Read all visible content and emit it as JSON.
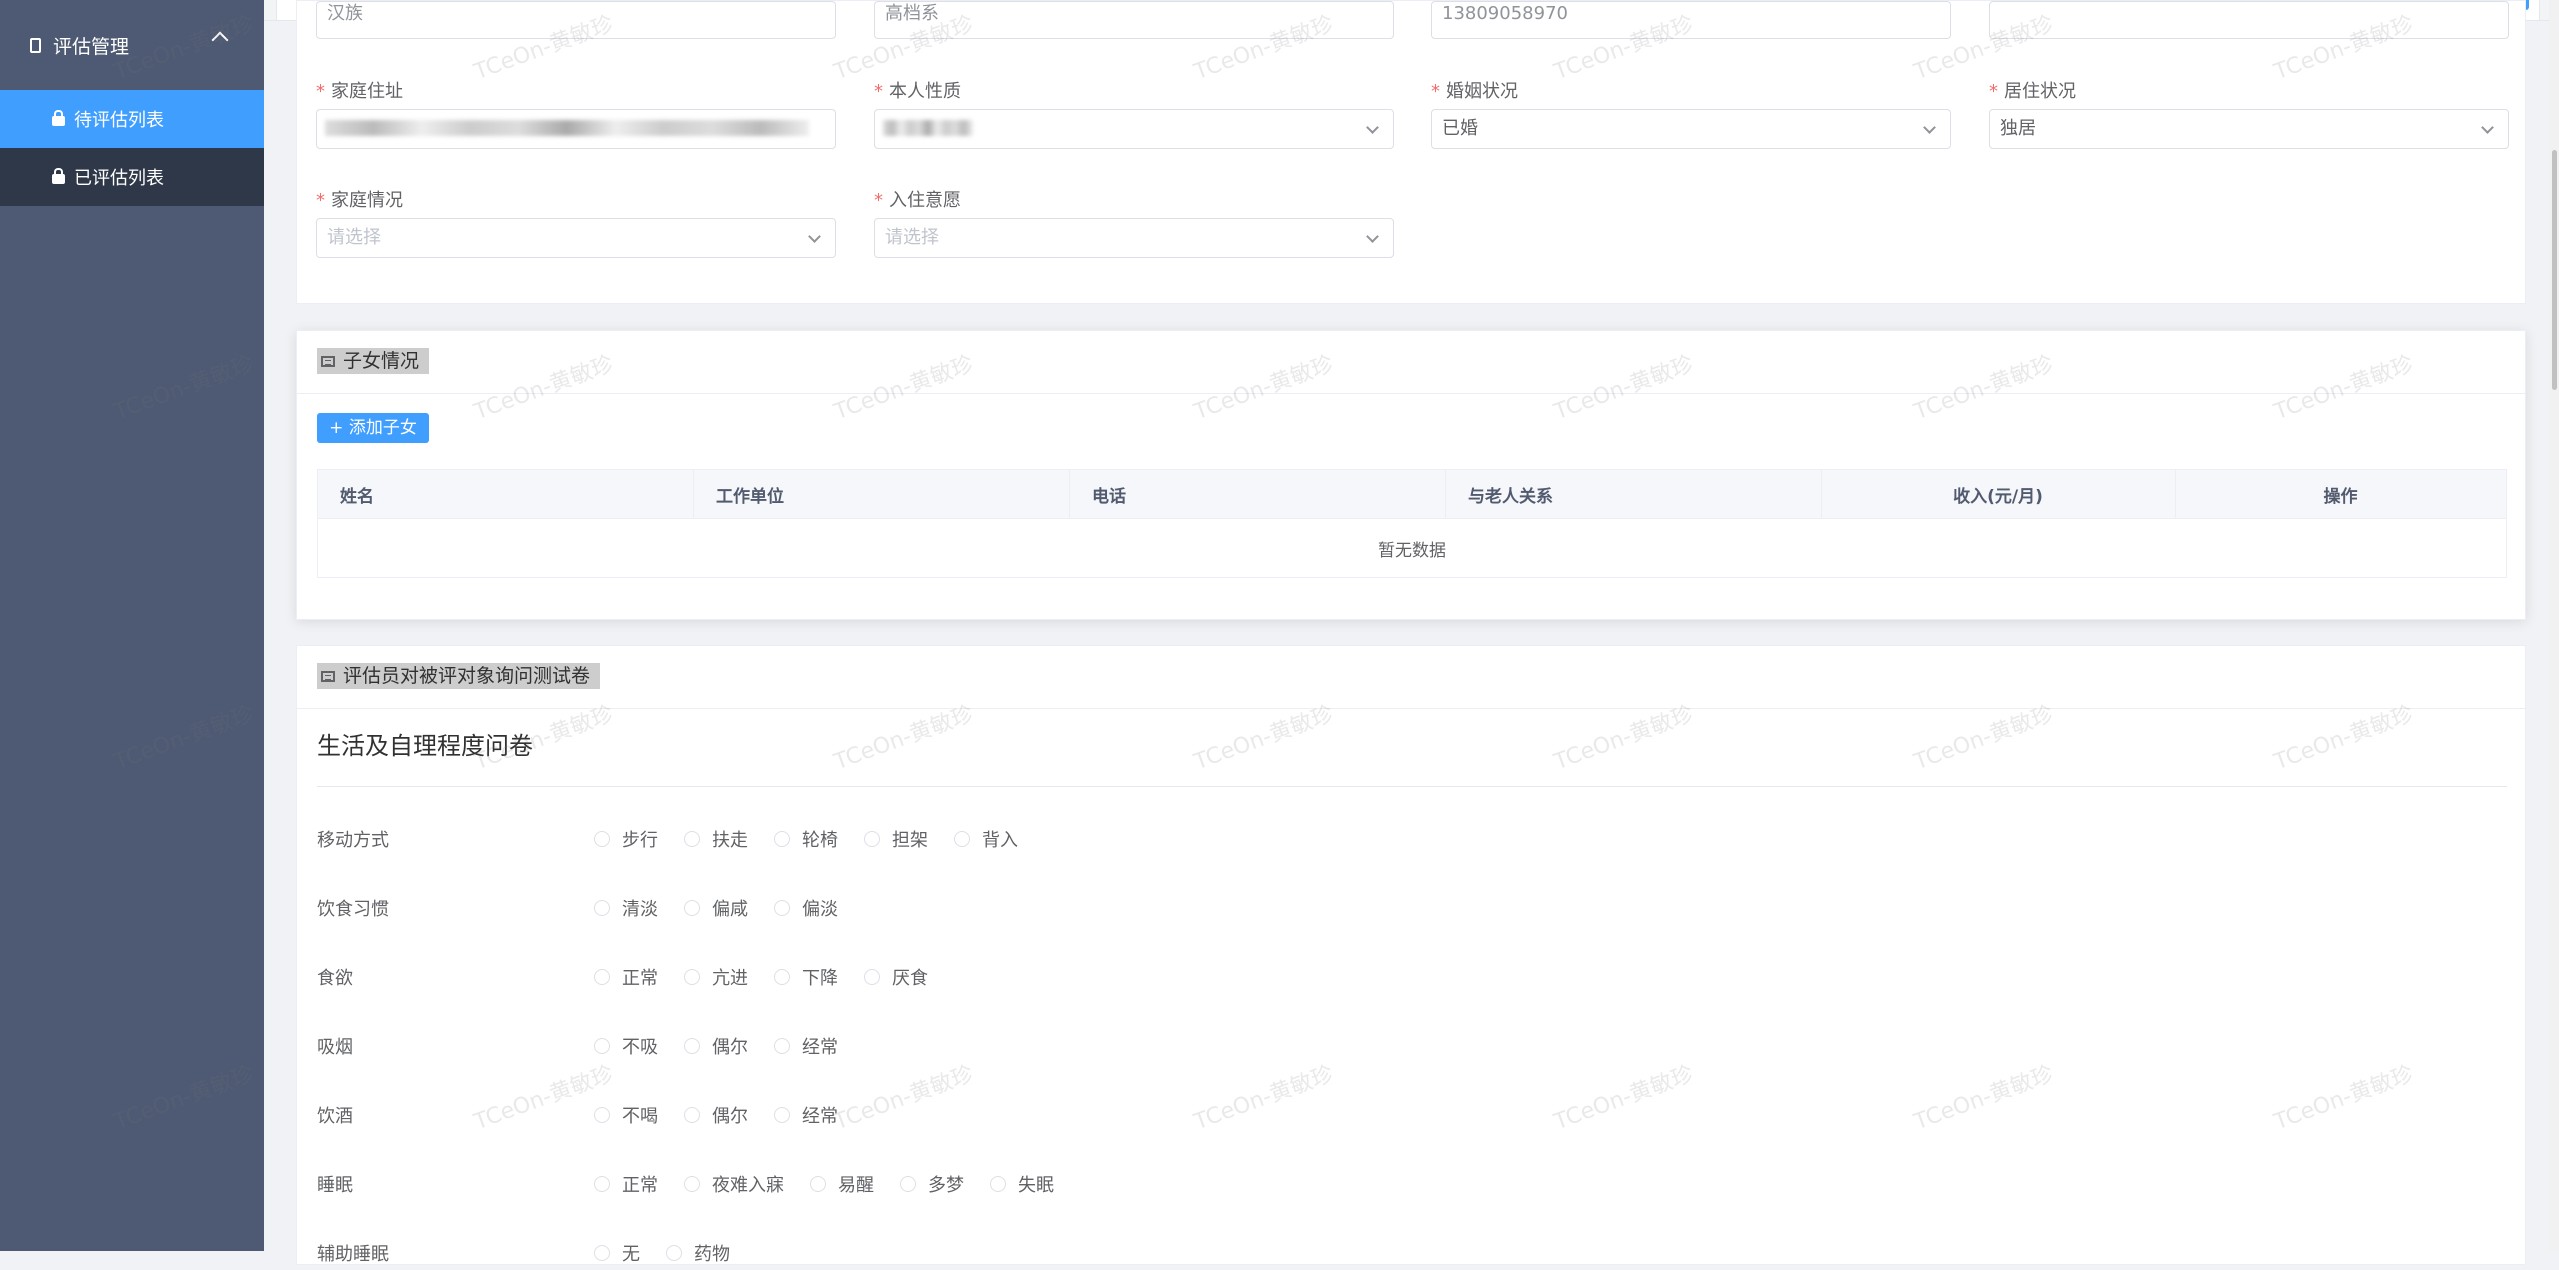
{
  "sidebar": {
    "group_label": "评估管理",
    "items": [
      {
        "label": "待评估列表",
        "active": true
      },
      {
        "label": "已评估列表",
        "active": false
      }
    ]
  },
  "top_fields": {
    "field1_value": "汉族",
    "field2_value": "高档系",
    "field3_value": "13809058970"
  },
  "form": {
    "row1": [
      {
        "label": "家庭住址",
        "required": true,
        "value": ""
      },
      {
        "label": "本人性质",
        "required": true,
        "value": ""
      },
      {
        "label": "婚姻状况",
        "required": true,
        "value": "已婚"
      },
      {
        "label": "居住状况",
        "required": true,
        "value": "独居"
      }
    ],
    "row2": [
      {
        "label": "家庭情况",
        "required": true,
        "placeholder": "请选择"
      },
      {
        "label": "入住意愿",
        "required": true,
        "placeholder": "请选择"
      }
    ]
  },
  "children_section": {
    "title": "子女情况",
    "add_button": "+ 添加子女",
    "columns": [
      "姓名",
      "工作单位",
      "电话",
      "与老人关系",
      "收入(元/月)",
      "操作"
    ],
    "empty_text": "暂无数据"
  },
  "questionnaire_section": {
    "title": "评估员对被评对象询问测试卷",
    "subtitle": "生活及自理程度问卷",
    "questions": [
      {
        "label": "移动方式",
        "options": [
          "步行",
          "扶走",
          "轮椅",
          "担架",
          "背入"
        ]
      },
      {
        "label": "饮食习惯",
        "options": [
          "清淡",
          "偏咸",
          "偏淡"
        ]
      },
      {
        "label": "食欲",
        "options": [
          "正常",
          "亢进",
          "下降",
          "厌食"
        ]
      },
      {
        "label": "吸烟",
        "options": [
          "不吸",
          "偶尔",
          "经常"
        ]
      },
      {
        "label": "饮酒",
        "options": [
          "不喝",
          "偶尔",
          "经常"
        ]
      },
      {
        "label": "睡眠",
        "options": [
          "正常",
          "夜难入寐",
          "易醒",
          "多梦",
          "失眠"
        ]
      },
      {
        "label": "辅助睡眠",
        "options": [
          "无",
          "药物"
        ]
      }
    ]
  },
  "watermark": "TCeOn-黄敏珍",
  "colors": {
    "primary": "#409eff",
    "sidebar": "#4e5a73",
    "sidebar_sub": "#2f3849",
    "required": "#f56c6c"
  }
}
